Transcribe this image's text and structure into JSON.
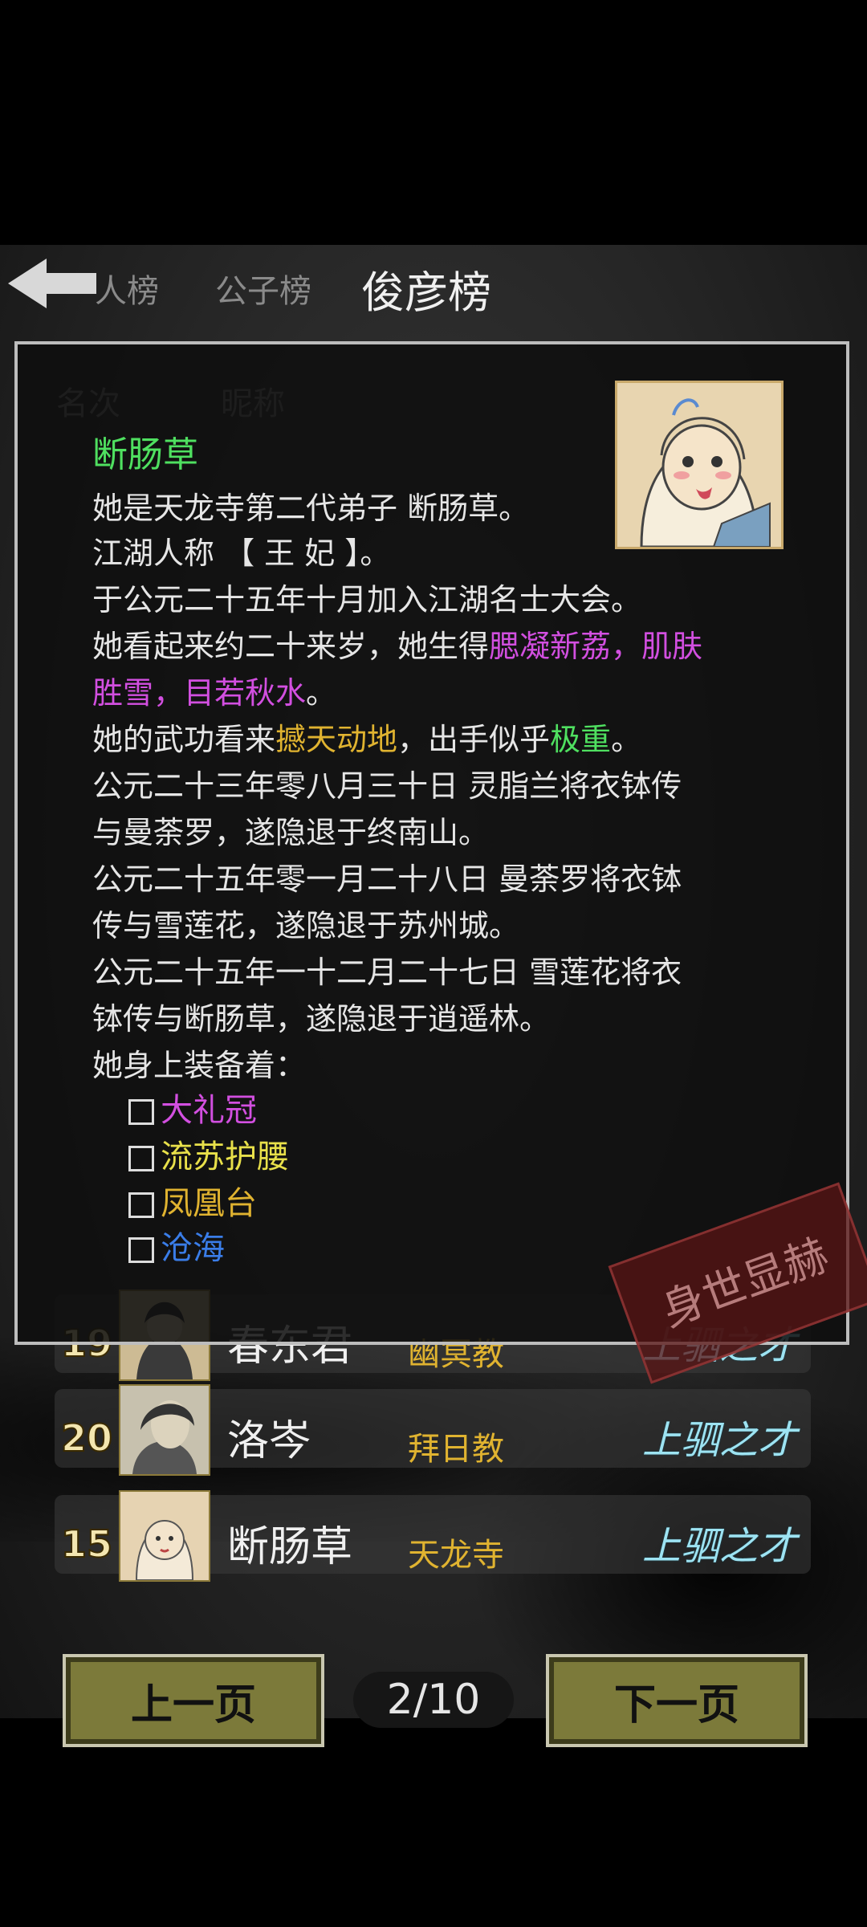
{
  "tabs": {
    "items": [
      "人榜",
      "公子榜",
      "俊彦榜"
    ],
    "active_index": 2
  },
  "columns": {
    "rank": "名次",
    "nickname": "昵称"
  },
  "rows": [
    {
      "rank": "19",
      "name": "春东君",
      "sect": "幽冥教",
      "title": "上驷之才"
    },
    {
      "rank": "20",
      "name": "洛岑",
      "sect": "拜日教",
      "title": "上驷之才"
    },
    {
      "rank": "15",
      "name": "断肠草",
      "sect": "天龙寺",
      "title": "上驷之才"
    }
  ],
  "pager": {
    "prev": "上一页",
    "next": "下一页",
    "page": "2/10"
  },
  "modal": {
    "name": "断肠草",
    "lines": {
      "l1": "她是天龙寺第二代弟子 断肠草。",
      "l2": "江湖人称 【 王  妃 】。",
      "l3": "于公元二十五年十月加入江湖名士大会。",
      "l4a": "她看起来约二十来岁，她生得",
      "l4b": "腮凝新荔，肌肤",
      "l5a": "胜雪，目若秋水",
      "l5b": "。",
      "l6a": "她的武功看来",
      "l6b": "撼天动地",
      "l6c": "，出手似乎",
      "l6d": "极重",
      "l6e": "。",
      "l7": "公元二十三年零八月三十日 灵脂兰将衣钵传",
      "l8": "与曼荼罗，遂隐退于终南山。",
      "l9": "公元二十五年零一月二十八日 曼荼罗将衣钵",
      "l10": "传与雪莲花，遂隐退于苏州城。",
      "l11": "公元二十五年一十二月二十七日 雪莲花将衣",
      "l12": "钵传与断肠草，遂隐退于逍遥林。",
      "l13": "她身上装备着："
    },
    "equipment": [
      {
        "name": "大礼冠",
        "color": "#d24fe0"
      },
      {
        "name": "流苏护腰",
        "color": "#e8e04a"
      },
      {
        "name": "凤凰台",
        "color": "#e0b330"
      },
      {
        "name": "沧海",
        "color": "#3a7de8"
      }
    ],
    "stamp": "身世显赫"
  }
}
